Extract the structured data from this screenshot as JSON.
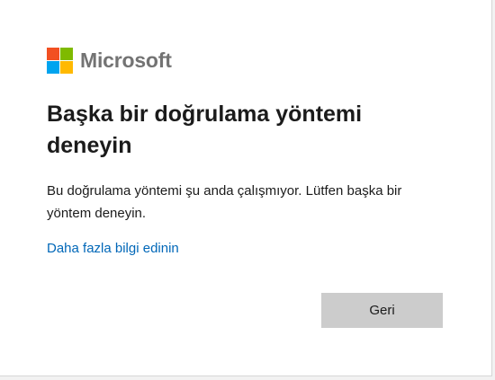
{
  "brand": {
    "name": "Microsoft",
    "logo_icon": "microsoft-four-squares-logo",
    "logo_colors": [
      "#f25022",
      "#7fba00",
      "#00a4ef",
      "#ffb900"
    ]
  },
  "dialog": {
    "title": "Başka bir doğrulama yöntemi deneyin",
    "description": "Bu doğrulama yöntemi şu anda çalışmıyor. Lütfen başka bir yöntem deneyin.",
    "learn_more_link": "Daha fazla bilgi edinin",
    "back_button": "Geri"
  },
  "colors": {
    "link": "#0067b8",
    "button_bg": "#cccccc",
    "text": "#1b1b1b"
  }
}
